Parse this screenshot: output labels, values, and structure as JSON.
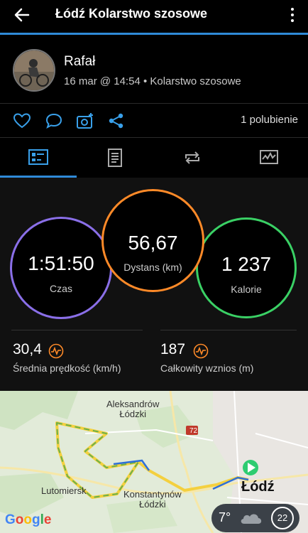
{
  "header": {
    "title": "Łódź Kolarstwo szosowe",
    "back_icon": "arrow-left-icon",
    "more_icon": "more-vertical-icon"
  },
  "profile": {
    "name": "Rafał",
    "meta": "16 mar @ 14:54 • Kolarstwo szosowe"
  },
  "actions": {
    "likes": "1 polubienie"
  },
  "tabs": [
    {
      "name": "overview",
      "icon": "summary-icon"
    },
    {
      "name": "details",
      "icon": "document-icon"
    },
    {
      "name": "laps",
      "icon": "loop-icon"
    },
    {
      "name": "charts",
      "icon": "chart-icon"
    }
  ],
  "stats": {
    "time": {
      "value": "1:51:50",
      "label": "Czas"
    },
    "distance": {
      "value": "56,67",
      "label": "Dystans (km)"
    },
    "calories": {
      "value": "1 237",
      "label": "Kalorie"
    },
    "avg_speed": {
      "value": "30,4",
      "label": "Średnia prędkość (km/h)"
    },
    "ascent": {
      "value": "187",
      "label": "Całkowity wznios (m)"
    }
  },
  "map": {
    "labels": {
      "aleksandrow": "Aleksandrów\nŁódzki",
      "lutomiersk": "Lutomiersk",
      "konstantynow": "Konstantynów\nŁódzki",
      "lodz": "Łódź",
      "road": "72"
    },
    "google": "Google",
    "weather": {
      "temp": "7°",
      "wind": "22"
    }
  },
  "colors": {
    "accent": "#2f8ad7",
    "time_ring": "#8a6fe8",
    "distance_ring": "#ff8a28",
    "calorie_ring": "#3ad165",
    "metric_icon": "#ff8a28"
  }
}
